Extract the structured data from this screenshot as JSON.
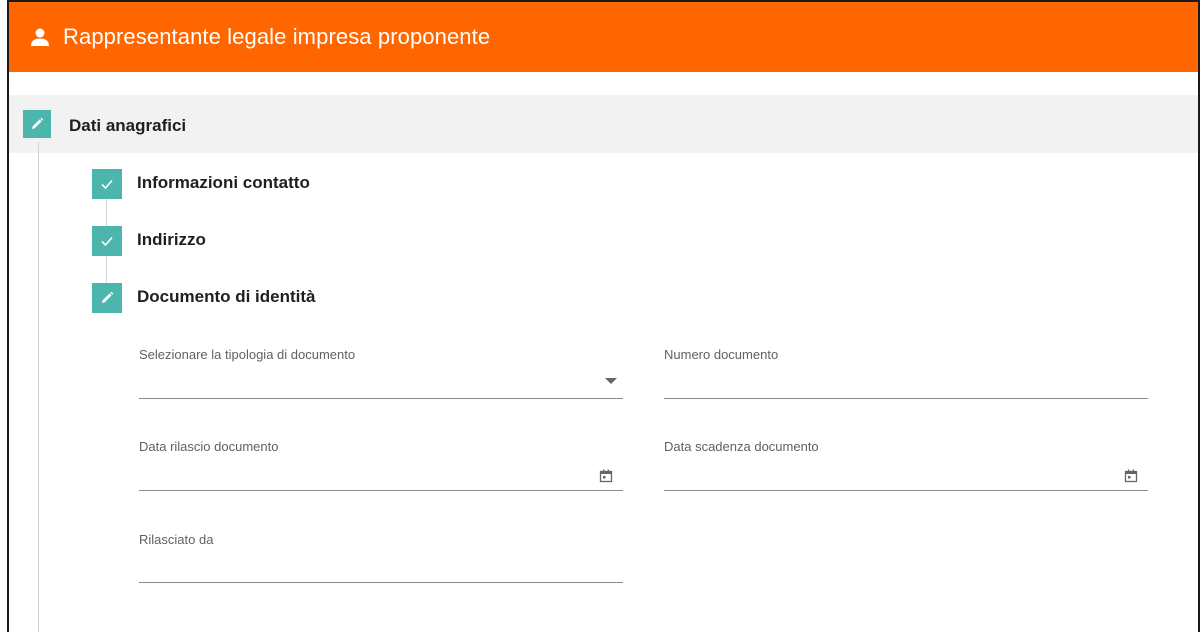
{
  "header": {
    "title": "Rappresentante legale impresa proponente",
    "icon": "user-icon",
    "bg_color": "#ff6600"
  },
  "section": {
    "title": "Dati anagrafici",
    "icon": "pencil-icon",
    "accent_color": "#4db6ac"
  },
  "steps": [
    {
      "label": "Informazioni contatto",
      "status": "completed",
      "icon": "check-icon"
    },
    {
      "label": "Indirizzo",
      "status": "completed",
      "icon": "check-icon"
    },
    {
      "label": "Documento di identità",
      "status": "editing",
      "icon": "pencil-icon"
    }
  ],
  "form": {
    "document_type": {
      "label": "Selezionare la tipologia di documento",
      "value": ""
    },
    "document_number": {
      "label": "Numero documento",
      "value": ""
    },
    "issue_date": {
      "label": "Data rilascio documento",
      "value": ""
    },
    "expiry_date": {
      "label": "Data scadenza documento",
      "value": ""
    },
    "issued_by": {
      "label": "Rilasciato da",
      "value": ""
    }
  }
}
